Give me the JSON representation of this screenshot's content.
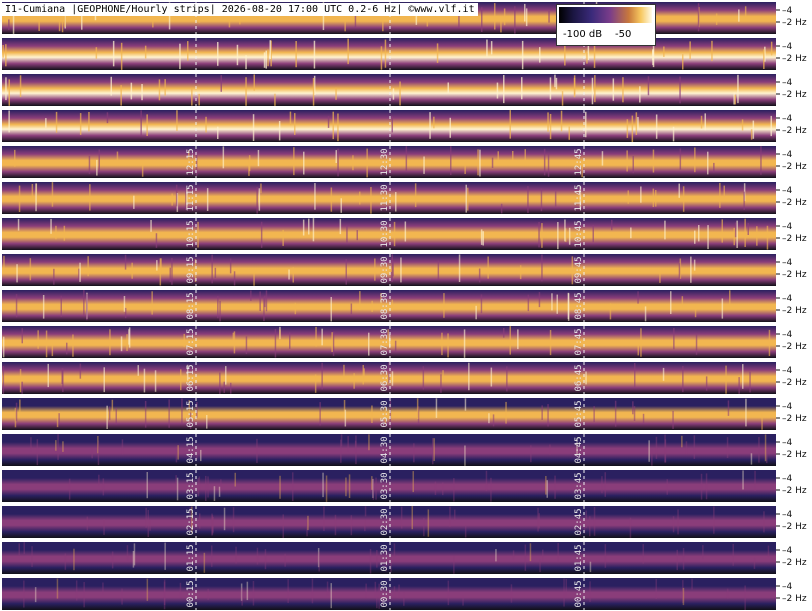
{
  "title": "I1-Cumiana |GEOPHONE/Hourly strips| 2026-08-20 17:00 UTC 0.2-6 Hz| ©www.vlf.it",
  "legend": {
    "low": "-100 dB",
    "high": "-50"
  },
  "colors": {
    "low": "#2a2060",
    "mid": "#8a3d7a",
    "high": "#f2b650",
    "peak": "#fff4d0"
  },
  "chart_data": {
    "type": "heatmap",
    "title": "I1-Cumiana |GEOPHONE/Hourly strips| 2026-08-20 17:00 UTC 0.2-6 Hz| ©www.vlf.it",
    "xlabel": "",
    "ylabel": "",
    "frequency_range_hz": [
      0.2,
      6
    ],
    "y_tick_labels": [
      "4",
      "2 Hz"
    ],
    "colorbar": {
      "min_db": -100,
      "max_db": -50,
      "labels": [
        "-100 dB",
        "-50"
      ]
    },
    "strips": [
      {
        "marks": [
          "",
          "",
          ""
        ],
        "intensity": 0.78
      },
      {
        "marks": [
          "",
          "",
          ""
        ],
        "intensity": 0.95
      },
      {
        "marks": [
          "",
          "",
          ""
        ],
        "intensity": 0.92
      },
      {
        "marks": [
          "",
          "",
          ""
        ],
        "intensity": 0.88
      },
      {
        "marks": [
          "12:15",
          "12:30",
          "12:45"
        ],
        "intensity": 0.72
      },
      {
        "marks": [
          "11:15",
          "11:30",
          "11:45"
        ],
        "intensity": 0.7
      },
      {
        "marks": [
          "10:15",
          "10:30",
          "10:45"
        ],
        "intensity": 0.74
      },
      {
        "marks": [
          "09:15",
          "09:30",
          "09:45"
        ],
        "intensity": 0.68
      },
      {
        "marks": [
          "08:15",
          "08:30",
          "08:45"
        ],
        "intensity": 0.66
      },
      {
        "marks": [
          "07:15",
          "07:30",
          "07:45"
        ],
        "intensity": 0.7
      },
      {
        "marks": [
          "06:15",
          "06:30",
          "06:45"
        ],
        "intensity": 0.66
      },
      {
        "marks": [
          "05:15",
          "05:30",
          "05:45"
        ],
        "intensity": 0.58
      },
      {
        "marks": [
          "04:15",
          "04:30",
          "04:45"
        ],
        "intensity": 0.34
      },
      {
        "marks": [
          "03:15",
          "03:30",
          "03:45"
        ],
        "intensity": 0.3
      },
      {
        "marks": [
          "02:15",
          "02:30",
          "02:45"
        ],
        "intensity": 0.28
      },
      {
        "marks": [
          "01:15",
          "01:30",
          "01:45"
        ],
        "intensity": 0.26
      },
      {
        "marks": [
          "00:15",
          "00:30",
          "00:45"
        ],
        "intensity": 0.24
      }
    ]
  }
}
